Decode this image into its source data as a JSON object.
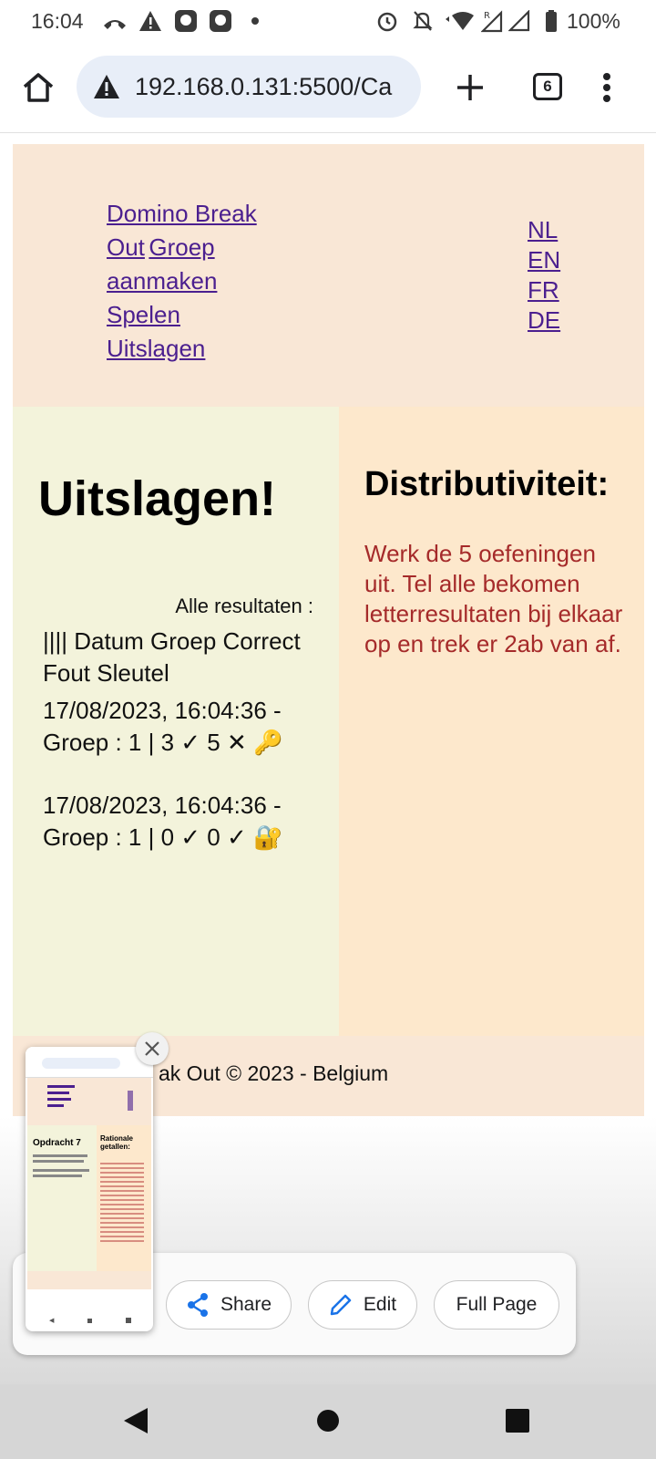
{
  "status_bar": {
    "time": "16:04",
    "battery": "100%"
  },
  "browser": {
    "url": "192.168.0.131:5500/Ca",
    "tab_count": "6",
    "icons": [
      "home-icon",
      "warning-icon",
      "new-tab-icon",
      "tab-switcher-icon",
      "more-menu-icon"
    ]
  },
  "header": {
    "nav": {
      "home": "Domino Break Out",
      "create_group": "Groep aanmaken",
      "play": "Spelen",
      "results": "Uitslagen"
    },
    "languages": [
      "NL",
      "EN",
      "FR",
      "DE"
    ]
  },
  "main": {
    "title": "Uitslagen!",
    "all_results_label": "Alle resultaten :",
    "table_header": "|||| Datum Groep Correct Fout Sleutel",
    "rows": [
      {
        "text": "17/08/2023, 16:04:36 - Groep : 1 | 3 ✓ 5 ✕ ",
        "icon": "🔑"
      },
      {
        "text": "17/08/2023, 16:04:36 - Groep : 1 | 0 ✓ 0 ✓ ",
        "icon": "🔐"
      }
    ]
  },
  "side": {
    "title": "Distributiviteit:",
    "text": "Werk de 5 oefeningen uit. Tel alle bekomen letterresultaten bij elkaar op en trek er 2ab van af."
  },
  "footer": {
    "text": "ak Out © 2023 - Belgium"
  },
  "screenshot_panel": {
    "share": "Share",
    "edit": "Edit",
    "full_page": "Full Page"
  },
  "thumbnail": {
    "opdracht": "Opdracht 7",
    "side_title": "Rationale getallen:"
  },
  "colors": {
    "header_bg": "#f9e7d6",
    "main_left_bg": "#f3f3db",
    "main_right_bg": "#fde8cc",
    "link": "#4b1f8f",
    "side_text": "#a52a2a"
  }
}
